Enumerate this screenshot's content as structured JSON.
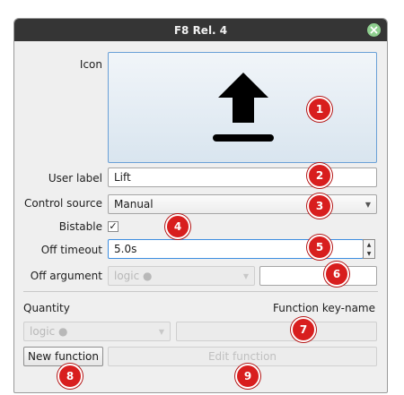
{
  "window": {
    "title": "F8 Rel. 4"
  },
  "labels": {
    "icon": "Icon",
    "user_label": "User label",
    "control_source": "Control source",
    "bistable": "Bistable",
    "off_timeout": "Off timeout",
    "off_argument": "Off argument",
    "quantity": "Quantity",
    "function_key_name": "Function key-name"
  },
  "fields": {
    "user_label_value": "Lift",
    "control_source_value": "Manual",
    "bistable_check": "✓",
    "off_timeout_value": "5.0s",
    "off_argument_value": "logic ●",
    "quantity_value": "logic ●"
  },
  "buttons": {
    "new_function": "New function",
    "edit_function": "Edit function"
  },
  "markers": [
    "1",
    "2",
    "3",
    "4",
    "5",
    "6",
    "7",
    "8",
    "9"
  ],
  "icons": {
    "main_icon": "upload-icon",
    "close": "close-icon"
  },
  "colors": {
    "marker": "#d81e1e",
    "focus": "#3d8ee0",
    "titlebar": "#353535"
  }
}
